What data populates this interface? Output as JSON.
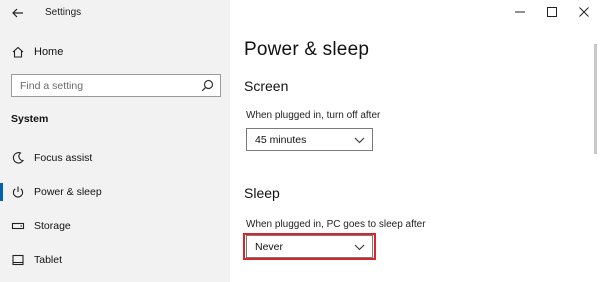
{
  "window": {
    "title": "Settings"
  },
  "sidebar": {
    "home_label": "Home",
    "search_placeholder": "Find a setting",
    "section": "System",
    "items": [
      {
        "label": "Focus assist",
        "icon": "moon-icon"
      },
      {
        "label": "Power & sleep",
        "icon": "power-icon",
        "active": true
      },
      {
        "label": "Storage",
        "icon": "storage-icon"
      },
      {
        "label": "Tablet",
        "icon": "tablet-icon"
      }
    ]
  },
  "main": {
    "page_title": "Power & sleep",
    "screen": {
      "heading": "Screen",
      "label": "When plugged in, turn off after",
      "value": "45 minutes"
    },
    "sleep": {
      "heading": "Sleep",
      "label": "When plugged in, PC goes to sleep after",
      "value": "Never"
    }
  },
  "colors": {
    "sidebar_bg": "#f2f2f2",
    "accent": "#0063b1",
    "highlight": "#d9232f"
  }
}
